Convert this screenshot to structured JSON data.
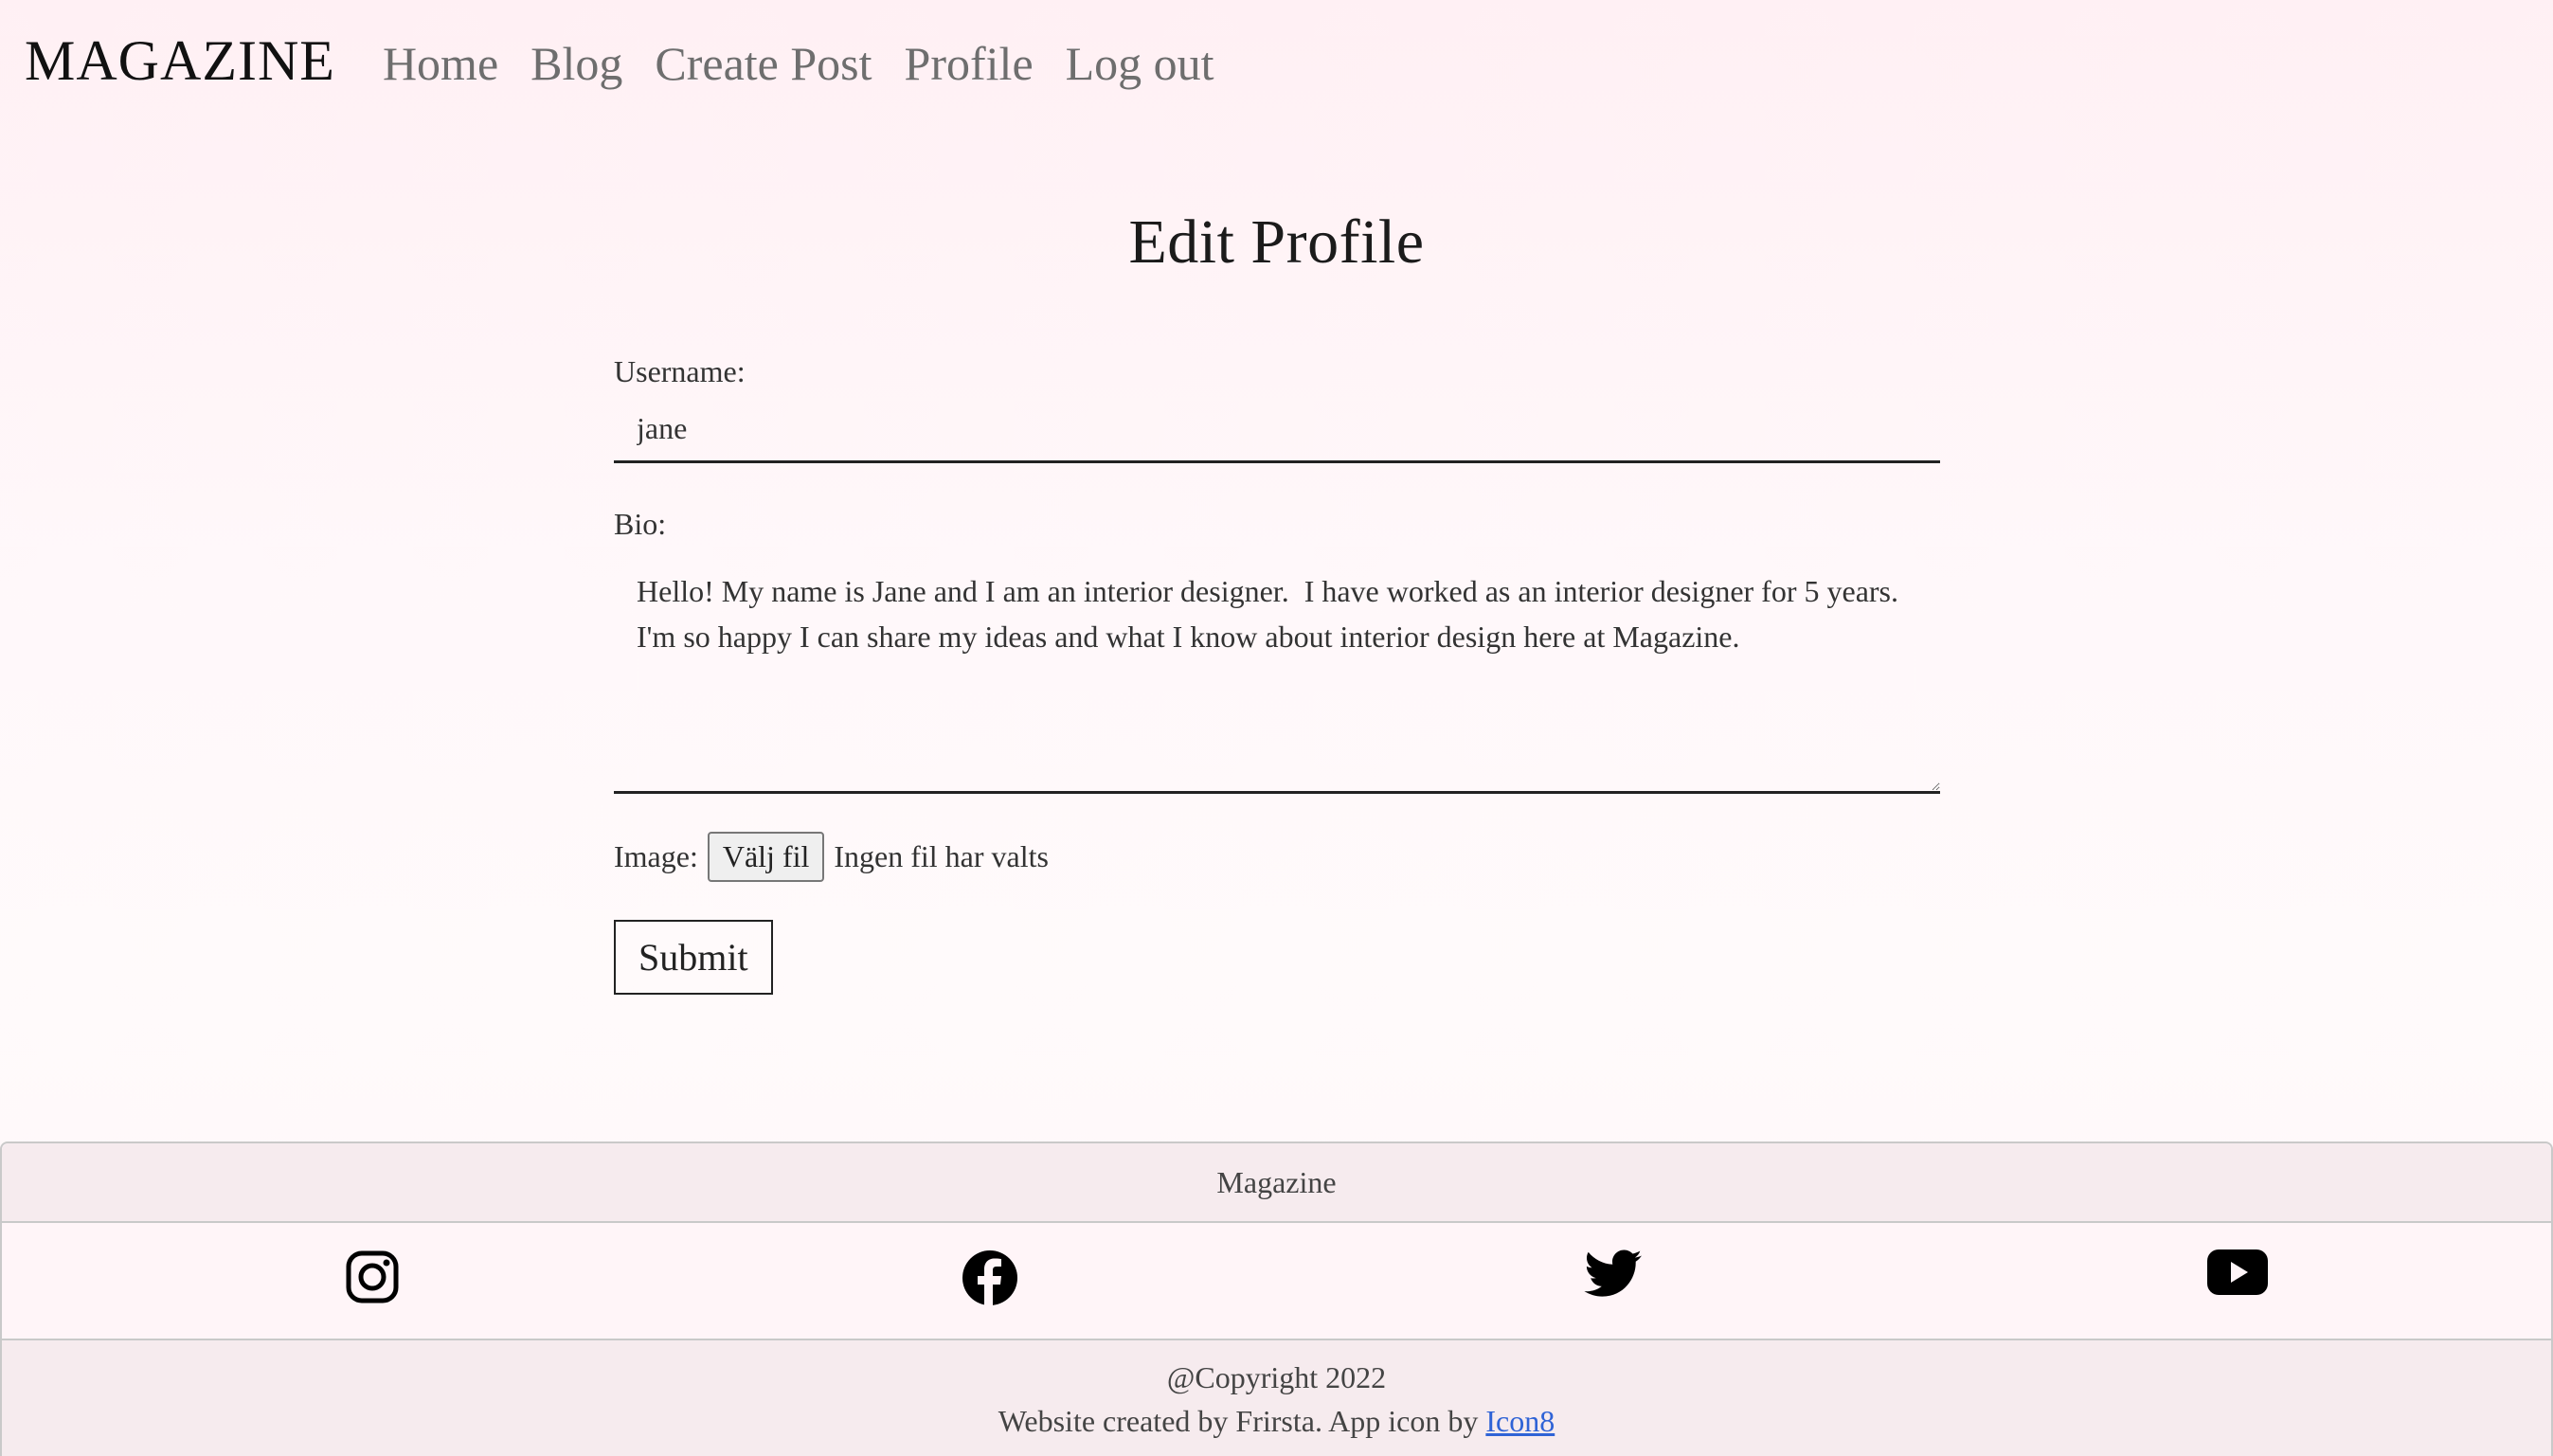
{
  "nav": {
    "brand": "MAGAZINE",
    "links": [
      "Home",
      "Blog",
      "Create Post",
      "Profile",
      "Log out"
    ]
  },
  "page": {
    "title": "Edit Profile"
  },
  "form": {
    "username_label": "Username:",
    "username_value": "jane",
    "bio_label": "Bio:",
    "bio_value": "Hello! My name is Jane and I am an interior designer.  I have worked as an interior designer for 5 years. I'm so happy I can share my ideas and what I know about interior design here at Magazine.",
    "image_label": "Image:",
    "file_button_label": "Välj fil",
    "file_status": "Ingen fil har valts",
    "submit_label": "Submit"
  },
  "footer": {
    "title": "Magazine",
    "social_icons": [
      "instagram-icon",
      "facebook-icon",
      "twitter-icon",
      "youtube-icon"
    ],
    "copyright": "@Copyright 2022",
    "credit_text": "Website created by Frirsta. App icon by",
    "credit_link": "Icon8"
  },
  "colors": {
    "link_blue": "#2f63d6",
    "nav_gray": "#6e6e6e",
    "background_pink": "#fff0f4"
  }
}
